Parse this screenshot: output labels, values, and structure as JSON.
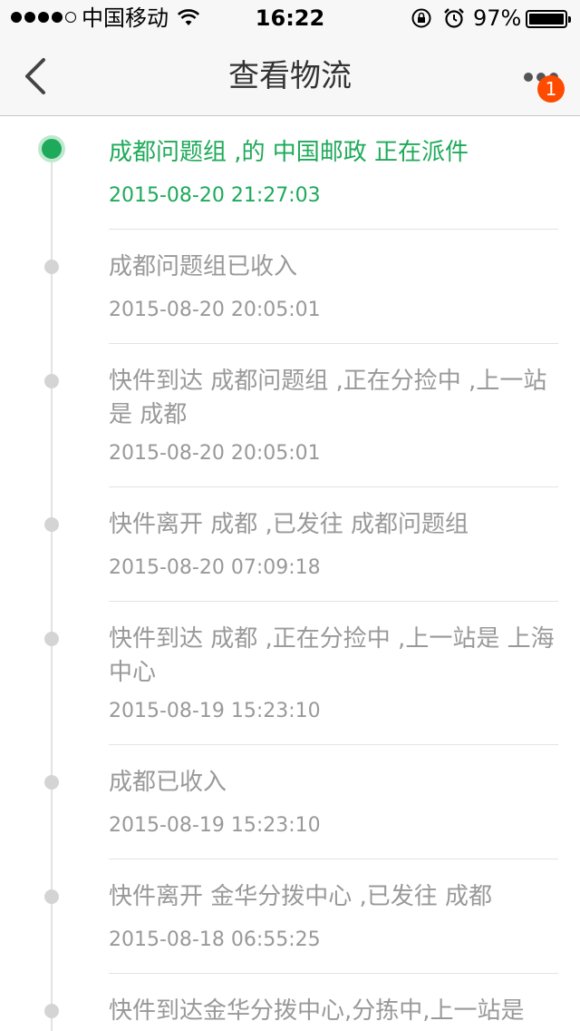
{
  "status_bar": {
    "carrier": "中国移动",
    "time": "16:22",
    "battery": "97%"
  },
  "nav": {
    "title": "查看物流",
    "badge": "1"
  },
  "icons": {
    "back": "chevron-left-icon",
    "more": "more-dots-icon",
    "wifi": "wifi-icon",
    "lock": "rotation-lock-icon",
    "alarm": "alarm-icon",
    "battery": "battery-icon"
  },
  "colors": {
    "active": "#1eaa5a",
    "inactive": "#999999",
    "badge": "#ff4b00"
  },
  "tracking": [
    {
      "desc": "成都问题组 ,的 中国邮政 正在派件",
      "time": "2015-08-20 21:27:03",
      "active": true
    },
    {
      "desc": "成都问题组已收入",
      "time": "2015-08-20 20:05:01"
    },
    {
      "desc": "快件到达 成都问题组 ,正在分捡中 ,上一站是 成都",
      "time": "2015-08-20 20:05:01"
    },
    {
      "desc": "快件离开 成都 ,已发往 成都问题组",
      "time": "2015-08-20 07:09:18"
    },
    {
      "desc": "快件到达 成都 ,正在分捡中 ,上一站是 上海中心",
      "time": "2015-08-19 15:23:10"
    },
    {
      "desc": "成都已收入",
      "time": "2015-08-19 15:23:10"
    },
    {
      "desc": "快件离开 金华分拨中心 ,已发往 成都",
      "time": "2015-08-18 06:55:25"
    },
    {
      "desc": "快件到达金华分拨中心,分拣中,上一站是",
      "time": ""
    }
  ]
}
